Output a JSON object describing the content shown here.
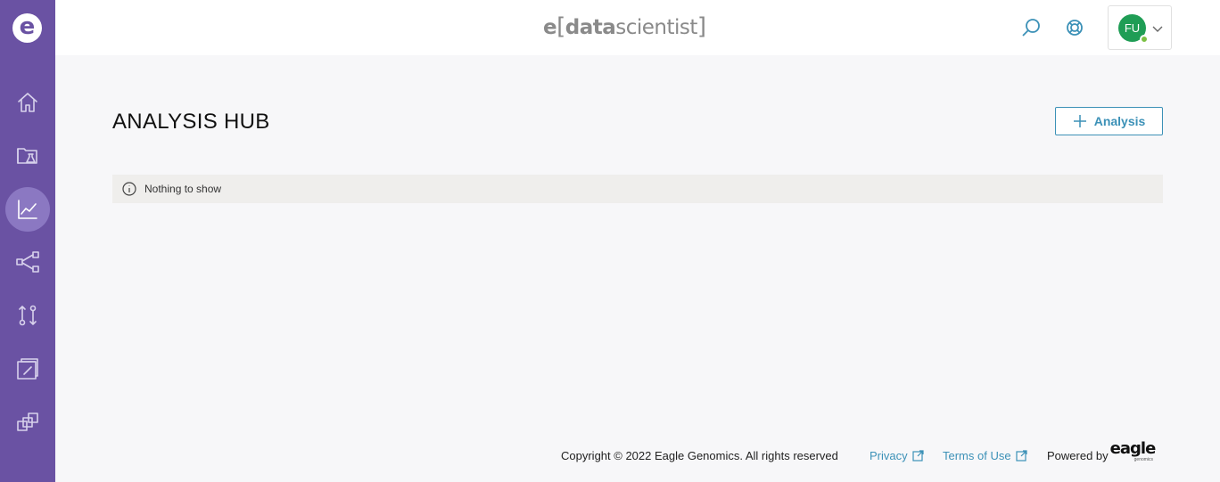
{
  "app": {
    "logo_letter": "e",
    "brand": {
      "e": "e",
      "open": "[",
      "data": "data",
      "rest": "scientist",
      "close": "]"
    }
  },
  "sidebar": {
    "items": [
      {
        "name": "home",
        "icon": "home-icon",
        "active": false
      },
      {
        "name": "data-explorer",
        "icon": "folder-flask-icon",
        "active": false
      },
      {
        "name": "analysis-hub",
        "icon": "line-chart-icon",
        "active": true
      },
      {
        "name": "workflows",
        "icon": "share-nodes-icon",
        "active": false
      },
      {
        "name": "transfers",
        "icon": "transfer-arrows-icon",
        "active": false
      },
      {
        "name": "reports",
        "icon": "book-icon",
        "active": false
      },
      {
        "name": "integrations",
        "icon": "stacked-squares-icon",
        "active": false
      }
    ]
  },
  "header": {
    "search_icon": "search-icon",
    "help_icon": "lifebuoy-icon",
    "user": {
      "initials": "FU",
      "status_color": "#7bc043",
      "avatar_color": "#1f9d55"
    }
  },
  "main": {
    "title": "ANALYSIS HUB",
    "add_button_label": "Analysis",
    "empty_message": "Nothing to show"
  },
  "footer": {
    "copyright": "Copyright © 2022 Eagle Genomics. All rights reserved",
    "privacy": "Privacy",
    "terms": "Terms of Use",
    "powered_by": "Powered by",
    "eagle_wordmark": "eagle",
    "eagle_sub": "genomics"
  },
  "colors": {
    "sidebar": "#6a52a3",
    "sidebar_active": "#8b78c2",
    "accent": "#3c91b7",
    "background": "#f7f7f9"
  }
}
